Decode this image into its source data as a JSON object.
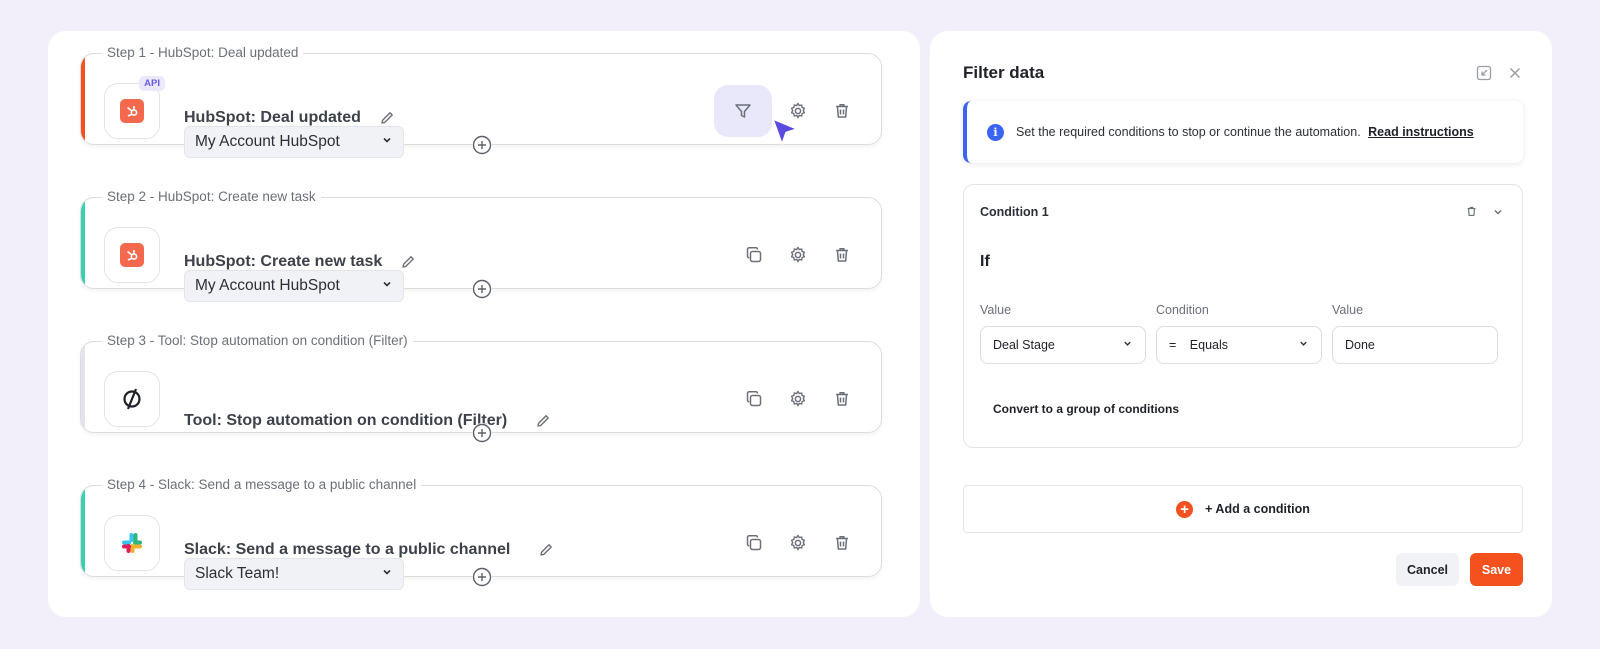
{
  "steps": [
    {
      "label": "Step 1 - HubSpot: Deal updated",
      "title": "HubSpot: Deal updated",
      "account": "My Account HubSpot",
      "badge": "API",
      "accent": "#f4511e",
      "icon": "hubspot-icon"
    },
    {
      "label": "Step 2 - HubSpot: Create new task",
      "title": "HubSpot: Create new task",
      "account": "My Account HubSpot",
      "accent": "#3ccfb0",
      "icon": "hubspot-icon"
    },
    {
      "label": "Step 3 - Tool: Stop automation on condition (Filter)",
      "title": "Tool: Stop automation on condition (Filter)",
      "accent": "#e3e4e9",
      "icon": "filter-tool-icon"
    },
    {
      "label": "Step 4 - Slack: Send a message to a public channel",
      "title": "Slack: Send a message to a public channel",
      "account": "Slack Team!",
      "accent": "#3ccfb0",
      "icon": "slack-icon"
    }
  ],
  "filter_panel": {
    "title": "Filter data",
    "info_text": "Set the required conditions to stop or continue the automation.",
    "info_link": "Read instructions",
    "condition": {
      "title": "Condition 1",
      "if_label": "If",
      "value_label": "Value",
      "condition_label": "Condition",
      "value2_label": "Value",
      "value_selected": "Deal Stage",
      "condition_sign": "=",
      "condition_selected": "Equals",
      "value2": "Done",
      "convert_link": "Convert to a group of conditions"
    },
    "add_condition": "+ Add a condition",
    "cancel": "Cancel",
    "save": "Save"
  },
  "colors": {
    "accent_orange": "#f4511e",
    "accent_teal": "#3ccfb0",
    "info_blue": "#3c64f4",
    "cursor_purple": "#5b4be0"
  }
}
